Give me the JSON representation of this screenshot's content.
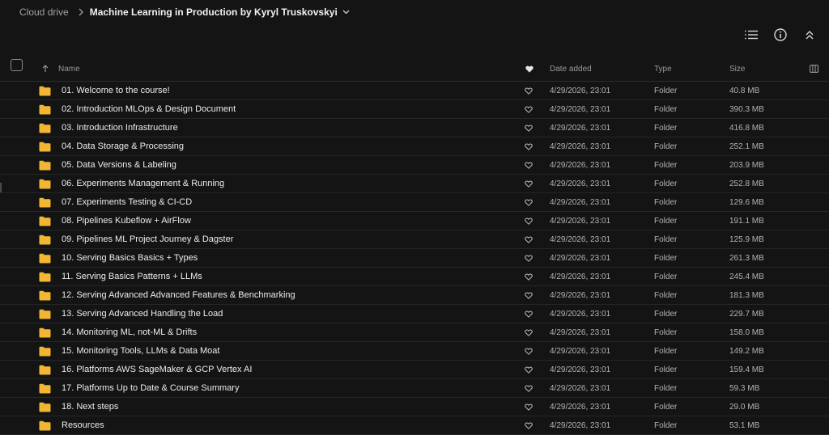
{
  "breadcrumb": {
    "root": "Cloud drive",
    "current": "Machine Learning in Production by Kyryl Truskovskyi"
  },
  "columns": {
    "name": "Name",
    "date": "Date added",
    "type": "Type",
    "size": "Size"
  },
  "colors": {
    "background": "#141414",
    "folder": "#f2b632",
    "text": "#ececec",
    "muted": "#9a9a9a"
  },
  "rows": [
    {
      "name": "01. Welcome to the course!",
      "date": "4/29/2026, 23:01",
      "type": "Folder",
      "size": "40.8 MB"
    },
    {
      "name": "02. Introduction MLOps & Design Document",
      "date": "4/29/2026, 23:01",
      "type": "Folder",
      "size": "390.3 MB"
    },
    {
      "name": "03. Introduction Infrastructure",
      "date": "4/29/2026, 23:01",
      "type": "Folder",
      "size": "416.8 MB"
    },
    {
      "name": "04. Data Storage & Processing",
      "date": "4/29/2026, 23:01",
      "type": "Folder",
      "size": "252.1 MB"
    },
    {
      "name": "05. Data Versions & Labeling",
      "date": "4/29/2026, 23:01",
      "type": "Folder",
      "size": "203.9 MB"
    },
    {
      "name": "06. Experiments Management & Running",
      "date": "4/29/2026, 23:01",
      "type": "Folder",
      "size": "252.8 MB"
    },
    {
      "name": "07. Experiments Testing & CI-CD",
      "date": "4/29/2026, 23:01",
      "type": "Folder",
      "size": "129.6 MB"
    },
    {
      "name": "08. Pipelines Kubeflow + AirFlow",
      "date": "4/29/2026, 23:01",
      "type": "Folder",
      "size": "191.1 MB"
    },
    {
      "name": "09. Pipelines ML Project Journey & Dagster",
      "date": "4/29/2026, 23:01",
      "type": "Folder",
      "size": "125.9 MB"
    },
    {
      "name": "10. Serving Basics Basics + Types",
      "date": "4/29/2026, 23:01",
      "type": "Folder",
      "size": "261.3 MB"
    },
    {
      "name": "11. Serving Basics Patterns + LLMs",
      "date": "4/29/2026, 23:01",
      "type": "Folder",
      "size": "245.4 MB"
    },
    {
      "name": "12. Serving Advanced Advanced Features & Benchmarking",
      "date": "4/29/2026, 23:01",
      "type": "Folder",
      "size": "181.3 MB"
    },
    {
      "name": "13. Serving Advanced Handling the Load",
      "date": "4/29/2026, 23:01",
      "type": "Folder",
      "size": "229.7 MB"
    },
    {
      "name": "14. Monitoring ML, not-ML & Drifts",
      "date": "4/29/2026, 23:01",
      "type": "Folder",
      "size": "158.0 MB"
    },
    {
      "name": "15. Monitoring Tools, LLMs & Data Moat",
      "date": "4/29/2026, 23:01",
      "type": "Folder",
      "size": "149.2 MB"
    },
    {
      "name": "16. Platforms AWS SageMaker & GCP Vertex AI",
      "date": "4/29/2026, 23:01",
      "type": "Folder",
      "size": "159.4 MB"
    },
    {
      "name": "17. Platforms Up to Date & Course Summary",
      "date": "4/29/2026, 23:01",
      "type": "Folder",
      "size": "59.3 MB"
    },
    {
      "name": "18. Next steps",
      "date": "4/29/2026, 23:01",
      "type": "Folder",
      "size": "29.0 MB"
    },
    {
      "name": "Resources",
      "date": "4/29/2026, 23:01",
      "type": "Folder",
      "size": "53.1 MB"
    }
  ]
}
